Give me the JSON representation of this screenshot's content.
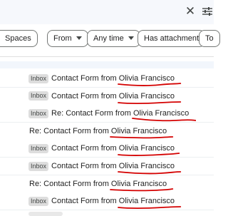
{
  "toolbar": {
    "close_icon": "close-icon",
    "tune_icon": "tune-icon"
  },
  "chips": {
    "spaces": "Spaces",
    "from": "From",
    "any_time": "Any time",
    "has_attachment": "Has attachment",
    "to": "To"
  },
  "colors": {
    "annotation_red": "#d40000",
    "badge_bg": "#dddddd",
    "toolbar_bg": "#f6f8fc"
  },
  "rows": [
    {
      "badge": "Inbox",
      "subject": "Contact Form from ",
      "name": "Olivia Francisco"
    },
    {
      "badge": "Inbox",
      "subject": "Contact Form from ",
      "name": "Olivia Francisco"
    },
    {
      "badge": "Inbox",
      "subject": "Re: Contact Form from ",
      "name": "Olivia Francisco"
    },
    {
      "badge": "",
      "subject": "Re: Contact Form from ",
      "name": "Olivia Francisco"
    },
    {
      "badge": "Inbox",
      "subject": "Contact Form from ",
      "name": "Olivia Francisco"
    },
    {
      "badge": "Inbox",
      "subject": "Contact Form from ",
      "name": "Olivia Francisco"
    },
    {
      "badge": "",
      "subject": "Re: Contact Form from ",
      "name": "Olivia Francisco"
    },
    {
      "badge": "Inbox",
      "subject": "Contact Form from ",
      "name": "Olivia Francisco"
    }
  ]
}
